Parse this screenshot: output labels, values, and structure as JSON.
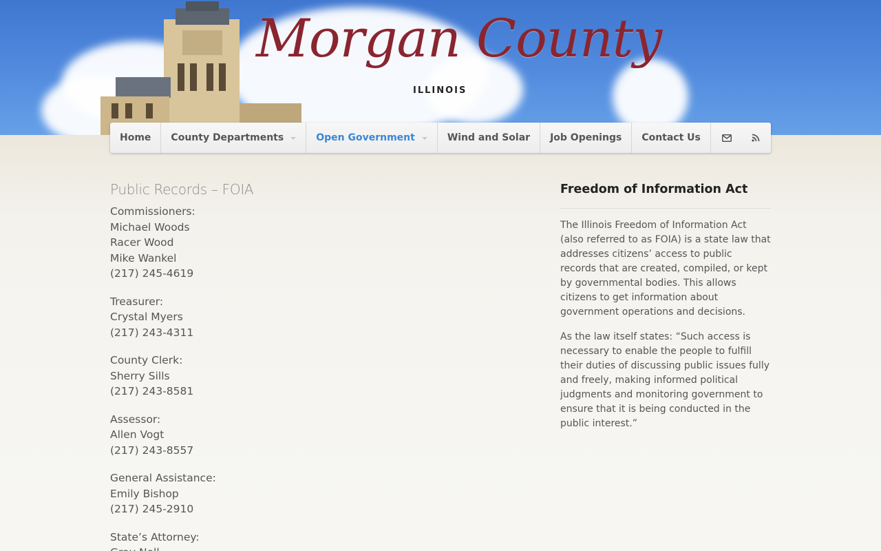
{
  "site": {
    "logo_script": "Morgan County",
    "logo_sub": "ILLINOIS"
  },
  "nav": {
    "items": [
      {
        "label": "Home",
        "has_dropdown": false,
        "active": false
      },
      {
        "label": "County Departments",
        "has_dropdown": true,
        "active": false
      },
      {
        "label": "Open Government",
        "has_dropdown": true,
        "active": true
      },
      {
        "label": "Wind and Solar",
        "has_dropdown": false,
        "active": false
      },
      {
        "label": "Job Openings",
        "has_dropdown": false,
        "active": false
      },
      {
        "label": "Contact Us",
        "has_dropdown": false,
        "active": false
      }
    ],
    "icons": [
      "envelope-icon",
      "rss-icon"
    ]
  },
  "main": {
    "title": "Public Records – FOIA",
    "offices": [
      {
        "lines": [
          "Commissioners:",
          "Michael Woods",
          "Racer Wood",
          "Mike Wankel",
          "(217) 245-4619"
        ]
      },
      {
        "lines": [
          "Treasurer:",
          "Crystal Myers",
          "(217) 243-4311"
        ]
      },
      {
        "lines": [
          "County Clerk:",
          "Sherry Sills",
          "(217) 243-8581"
        ]
      },
      {
        "lines": [
          "Assessor:",
          "Allen Vogt",
          "(217) 243-8557"
        ]
      },
      {
        "lines": [
          "General Assistance:",
          "Emily Bishop",
          "(217) 245-2910"
        ]
      },
      {
        "lines": [
          "State’s Attorney:",
          "Gray Noll"
        ]
      }
    ]
  },
  "sidebar": {
    "title": "Freedom of Information Act",
    "paragraphs": [
      "The Illinois Freedom of Information Act (also referred to as FOIA) is a state law that addresses citizens’ access to public records that are created, compiled, or kept by governmental bodies. This allows citizens to get information about government operations and decisions.",
      "As the law itself states: “Such access is necessary to enable the people to fulfill their duties of discussing public issues fully and freely, making informed political judgments and monitoring government to ensure that it is being conducted in the public interest.”"
    ]
  },
  "colors": {
    "accent": "#3a87d5",
    "logo": "#8a2530",
    "sky": "#4f88dc"
  }
}
